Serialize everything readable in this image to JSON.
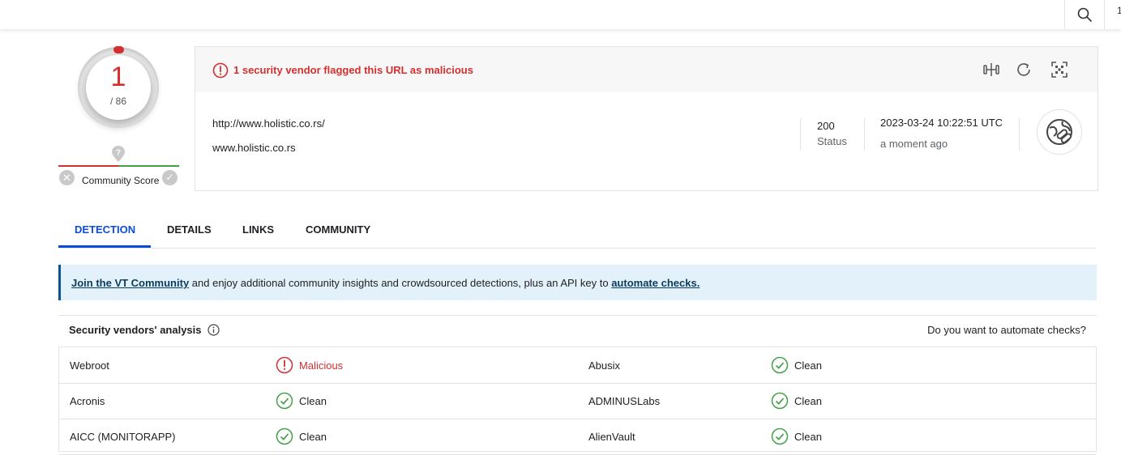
{
  "header": {
    "right_edge_text": "1"
  },
  "score": {
    "detections": "1",
    "total": "/ 86",
    "community_label": "Community Score"
  },
  "summary": {
    "alert": "1 security vendor flagged this URL as malicious",
    "url": "http://www.holistic.co.rs/",
    "domain": "www.holistic.co.rs",
    "status_code": "200",
    "status_label": "Status",
    "date": "2023-03-24 10:22:51 UTC",
    "relative_time": "a moment ago"
  },
  "tabs": [
    {
      "label": "DETECTION",
      "active": true
    },
    {
      "label": "DETAILS"
    },
    {
      "label": "LINKS"
    },
    {
      "label": "COMMUNITY"
    }
  ],
  "banner": {
    "link1": "Join the VT Community",
    "text": " and enjoy additional community insights and crowdsourced detections, plus an API key to ",
    "link2": "automate checks."
  },
  "vendors": {
    "title": "Security vendors' analysis",
    "right_text": "Do you want to automate checks?",
    "rows": [
      {
        "v1": "Webroot",
        "r1": "Malicious",
        "v2": "Abusix",
        "r2": "Clean"
      },
      {
        "v1": "Acronis",
        "r1": "Clean",
        "v2": "ADMINUSLabs",
        "r2": "Clean"
      },
      {
        "v1": "AICC (MONITORAPP)",
        "r1": "Clean",
        "v2": "AlienVault",
        "r2": "Clean"
      }
    ]
  },
  "colors": {
    "malicious": "#d32f2f",
    "clean": "#43a047",
    "accent": "#0b4dda",
    "banner_bg": "#e3f1fb"
  },
  "icons": [
    "search-icon",
    "alert-icon",
    "compare-icon",
    "refresh-icon",
    "qr-icon",
    "url-link-icon",
    "info-icon",
    "check-icon",
    "question-pin-icon"
  ]
}
